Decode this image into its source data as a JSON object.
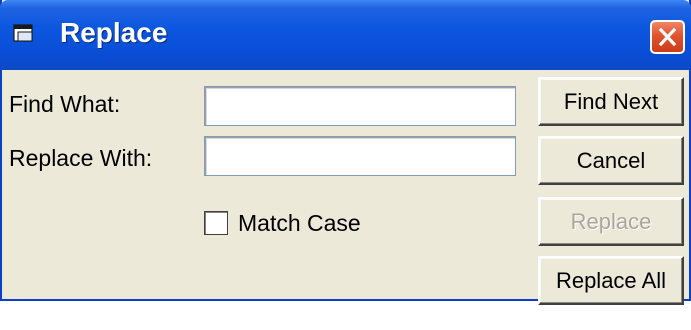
{
  "window": {
    "title": "Replace"
  },
  "form": {
    "find_what_label": "Find What:",
    "find_what_value": "",
    "replace_with_label": "Replace With:",
    "replace_with_value": "",
    "match_case_label": "Match Case",
    "match_case_checked": false
  },
  "buttons": {
    "find_next": "Find Next",
    "cancel": "Cancel",
    "replace": "Replace",
    "replace_all": "Replace All"
  },
  "colors": {
    "titlebar": "#0a4ed6",
    "window_bg": "#ece9d8",
    "close_button": "#e0532f",
    "disabled_text": "#a9a79d"
  },
  "icons": {
    "app": "window-app-icon",
    "close": "close-icon"
  }
}
